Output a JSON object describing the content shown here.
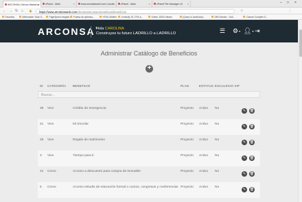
{
  "browser": {
    "tabs": [
      {
        "label": "ARCONSA | Nexus Maestros"
      },
      {
        "label": "cPanel - Main"
      },
      {
        "label": "www.arnoticiaweb.com | locali..."
      },
      {
        "label": "cPanel - Main"
      },
      {
        "label": "cPanel File Manager v3"
      }
    ],
    "url_host": "https://www.arnoticiaweb.com",
    "url_path": "/clientes/arconsa-beneficios/beneficios",
    "secure_label": "Seguro",
    "bookmarks": [
      "Favoritos",
      "Webmaster Tools G...",
      "PageSpeed Insights",
      "Prueba de optimiza...",
      "HTML Minifier",
      "Unminify JS, CSS a...",
      "Online JSON Viewer",
      "jQuery is JavaScript...",
      "Diff Checker - Onli...",
      "Closure Compiler S..."
    ]
  },
  "header": {
    "logo": "ARCONSA",
    "greeting": "Hola",
    "user_name": "CAROLINA",
    "slogan": "Construyes tu futuro LADRILLO a LADRILLO"
  },
  "page": {
    "title": "Administrar Catálogo de Beneficios",
    "add_label": "+"
  },
  "table": {
    "columns": [
      "ID",
      "CATEGORÍA",
      "BENEFICIO",
      "PLAN",
      "ESTATUS",
      "EXCLUSIVO VIP"
    ],
    "search_placeholder": "Buscar...",
    "rows": [
      {
        "id": "39",
        "categoria": "Vive",
        "beneficio": "Crédito de emergencia",
        "plan": "Proyecto",
        "estatus": "Activo",
        "vip": "No"
      },
      {
        "id": "21",
        "categoria": "Vive",
        "beneficio": "Kit Escolar",
        "plan": "Proyecto",
        "estatus": "Activo",
        "vip": "No"
      },
      {
        "id": "25",
        "categoria": "Vive",
        "beneficio": "Regalo de matrimonio",
        "plan": "Proyecto",
        "estatus": "Activo",
        "vip": "No"
      },
      {
        "id": "3",
        "categoria": "Vive",
        "beneficio": "Tiempo para ti",
        "plan": "Proyecto",
        "estatus": "Activo",
        "vip": "No"
      },
      {
        "id": "31",
        "categoria": "Crece",
        "beneficio": "Acceso a descuento para compra de inmueble",
        "plan": "Proyecto",
        "estatus": "Activo",
        "vip": "No"
      },
      {
        "id": "5",
        "categoria": "Crece",
        "beneficio": "Acceso estudio de educación formal o cursos, congresos y conferencias",
        "plan": "Proyecto",
        "estatus": "Activo",
        "vip": "No"
      }
    ]
  }
}
